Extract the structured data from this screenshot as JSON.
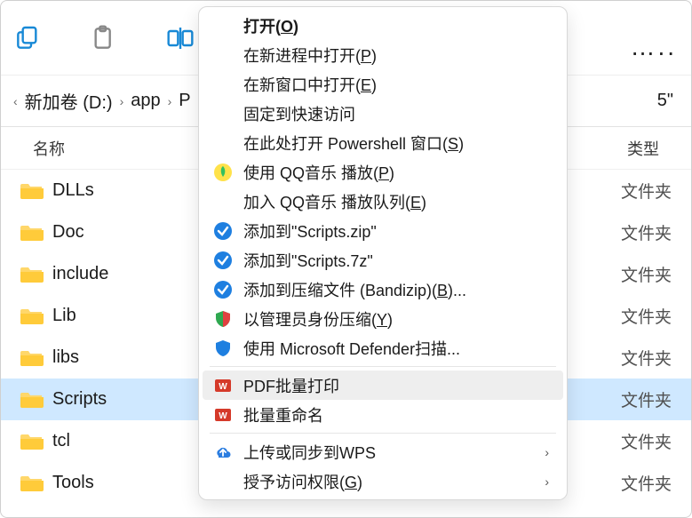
{
  "toolbar": {
    "more": "…"
  },
  "breadcrumb": {
    "crumb_0": "新加卷 (D:)",
    "crumb_1": "app",
    "crumb_2_trunc": "P",
    "right_trunc": "5\""
  },
  "columns": {
    "name": "名称",
    "type": "类型"
  },
  "type_folder": "文件夹",
  "files": [
    {
      "name": "DLLs"
    },
    {
      "name": "Doc"
    },
    {
      "name": "include"
    },
    {
      "name": "Lib"
    },
    {
      "name": "libs"
    },
    {
      "name": "Scripts",
      "selected": true
    },
    {
      "name": "tcl"
    },
    {
      "name": "Tools"
    }
  ],
  "context_menu": {
    "open": "打开(",
    "open_key": "O",
    "open_tail": ")",
    "open_new_process": "在新进程中打开(",
    "open_new_process_key": "P",
    "open_new_process_tail": ")",
    "open_new_window": "在新窗口中打开(",
    "open_new_window_key": "E",
    "open_new_window_tail": ")",
    "pin_quick": "固定到快速访问",
    "open_ps": "在此处打开 Powershell 窗口(",
    "open_ps_key": "S",
    "open_ps_tail": ")",
    "qq_play": "使用 QQ音乐 播放(",
    "qq_play_key": "P",
    "qq_play_tail": ")",
    "qq_queue": "加入 QQ音乐 播放队列(",
    "qq_queue_key": "E",
    "qq_queue_tail": ")",
    "bz_zip": "添加到\"Scripts.zip\"",
    "bz_7z": "添加到\"Scripts.7z\"",
    "bz_add": "添加到压缩文件 (Bandizip)(",
    "bz_add_key": "B",
    "bz_add_tail": ")...",
    "bz_admin": "以管理员身份压缩(",
    "bz_admin_key": "Y",
    "bz_admin_tail": ")",
    "defender": "使用 Microsoft Defender扫描...",
    "wps_pdf": "PDF批量打印",
    "wps_rename": "批量重命名",
    "wps_sync": "上传或同步到WPS",
    "grant_access": "授予访问权限(",
    "grant_access_key": "G",
    "grant_access_tail": ")"
  }
}
